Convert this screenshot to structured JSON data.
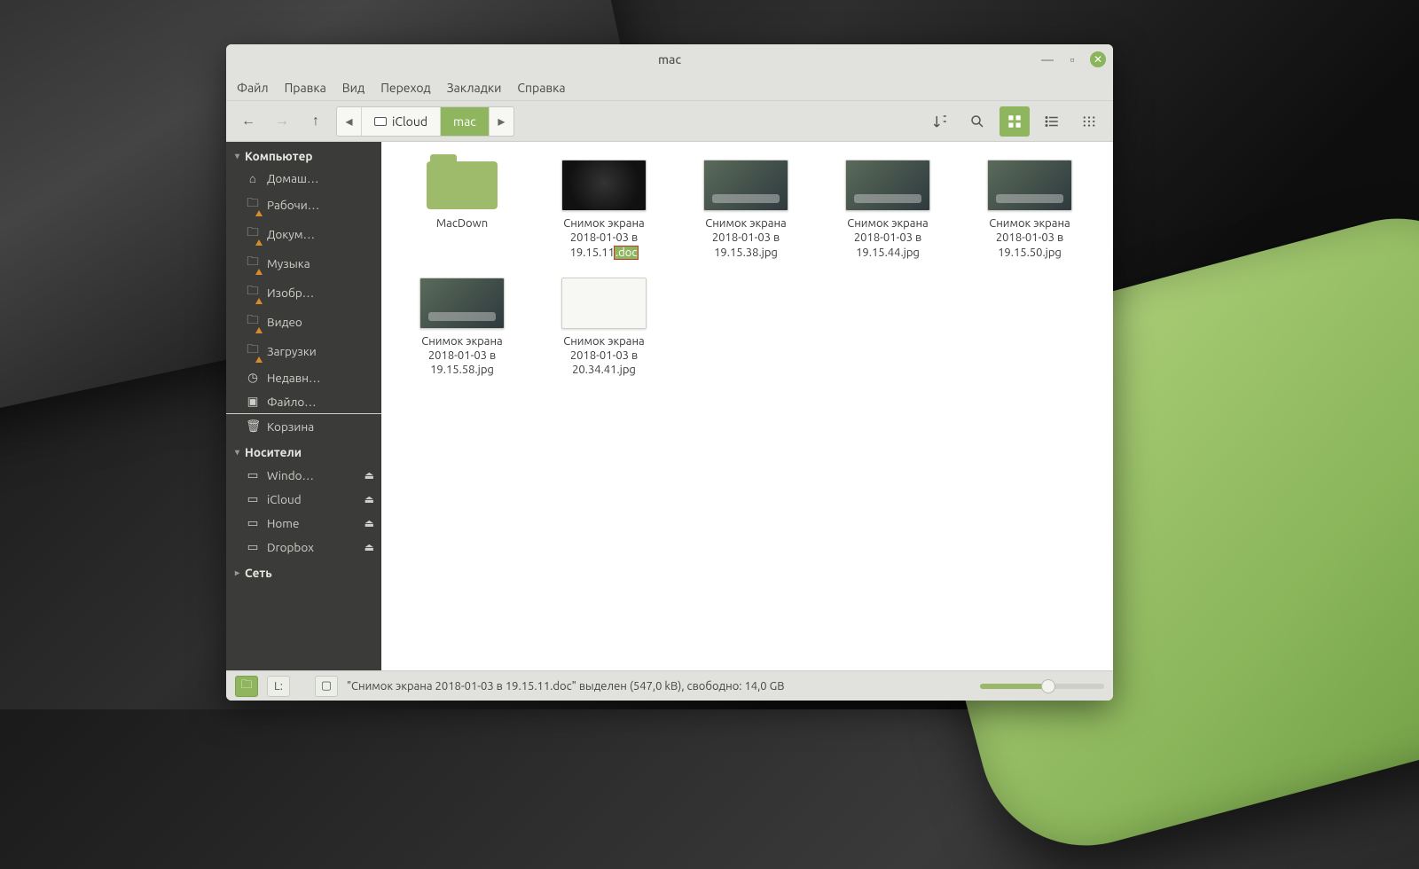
{
  "window": {
    "title": "mac"
  },
  "menubar": [
    "Файл",
    "Правка",
    "Вид",
    "Переход",
    "Закладки",
    "Справка"
  ],
  "toolbar": {
    "path": [
      {
        "label": "iCloud",
        "active": false,
        "drive": true
      },
      {
        "label": "mac",
        "active": true,
        "drive": false
      }
    ]
  },
  "sidebar": {
    "sections": [
      {
        "title": "Компьютер",
        "items": [
          {
            "icon": "home",
            "label": "Домаш…"
          },
          {
            "icon": "folder-w",
            "label": "Рабочи…"
          },
          {
            "icon": "folder-w",
            "label": "Докум…"
          },
          {
            "icon": "folder-w",
            "label": "Музыка"
          },
          {
            "icon": "folder-w",
            "label": "Изобр…"
          },
          {
            "icon": "folder-w",
            "label": "Видео"
          },
          {
            "icon": "folder-w",
            "label": "Загрузки"
          },
          {
            "icon": "clock",
            "label": "Недавн…"
          },
          {
            "icon": "disk",
            "label": "Файло…",
            "active": true
          },
          {
            "icon": "trash",
            "label": "Корзина"
          }
        ]
      },
      {
        "title": "Носители",
        "items": [
          {
            "icon": "drive",
            "label": "Windo…",
            "eject": true
          },
          {
            "icon": "drive",
            "label": "iCloud",
            "eject": true
          },
          {
            "icon": "drive",
            "label": "Home",
            "eject": true
          },
          {
            "icon": "drive",
            "label": "Dropbox",
            "eject": true
          }
        ]
      },
      {
        "title": "Сеть",
        "items": []
      }
    ]
  },
  "files": [
    {
      "type": "folder",
      "name": "MacDown"
    },
    {
      "type": "image-dark",
      "name_l1": "Снимок экрана",
      "name_l2": "2018-01-03 в",
      "name_l3a": "19.15.11",
      "name_ext": ".doc",
      "editing": true
    },
    {
      "type": "image",
      "name_l1": "Снимок экрана",
      "name_l2": "2018-01-03 в",
      "name_l3": "19.15.38.jpg"
    },
    {
      "type": "image",
      "name_l1": "Снимок экрана",
      "name_l2": "2018-01-03 в",
      "name_l3": "19.15.44.jpg"
    },
    {
      "type": "image",
      "name_l1": "Снимок экрана",
      "name_l2": "2018-01-03 в",
      "name_l3": "19.15.50.jpg"
    },
    {
      "type": "image",
      "name_l1": "Снимок экрана",
      "name_l2": "2018-01-03 в",
      "name_l3": "19.15.58.jpg"
    },
    {
      "type": "image-light",
      "name_l1": "Снимок экрана",
      "name_l2": "2018-01-03 в",
      "name_l3": "20.34.41.jpg"
    }
  ],
  "statusbar": {
    "text": "\"Снимок экрана 2018-01-03 в 19.15.11.doc\" выделен (547,0 kB), свободно: 14,0 GB"
  }
}
